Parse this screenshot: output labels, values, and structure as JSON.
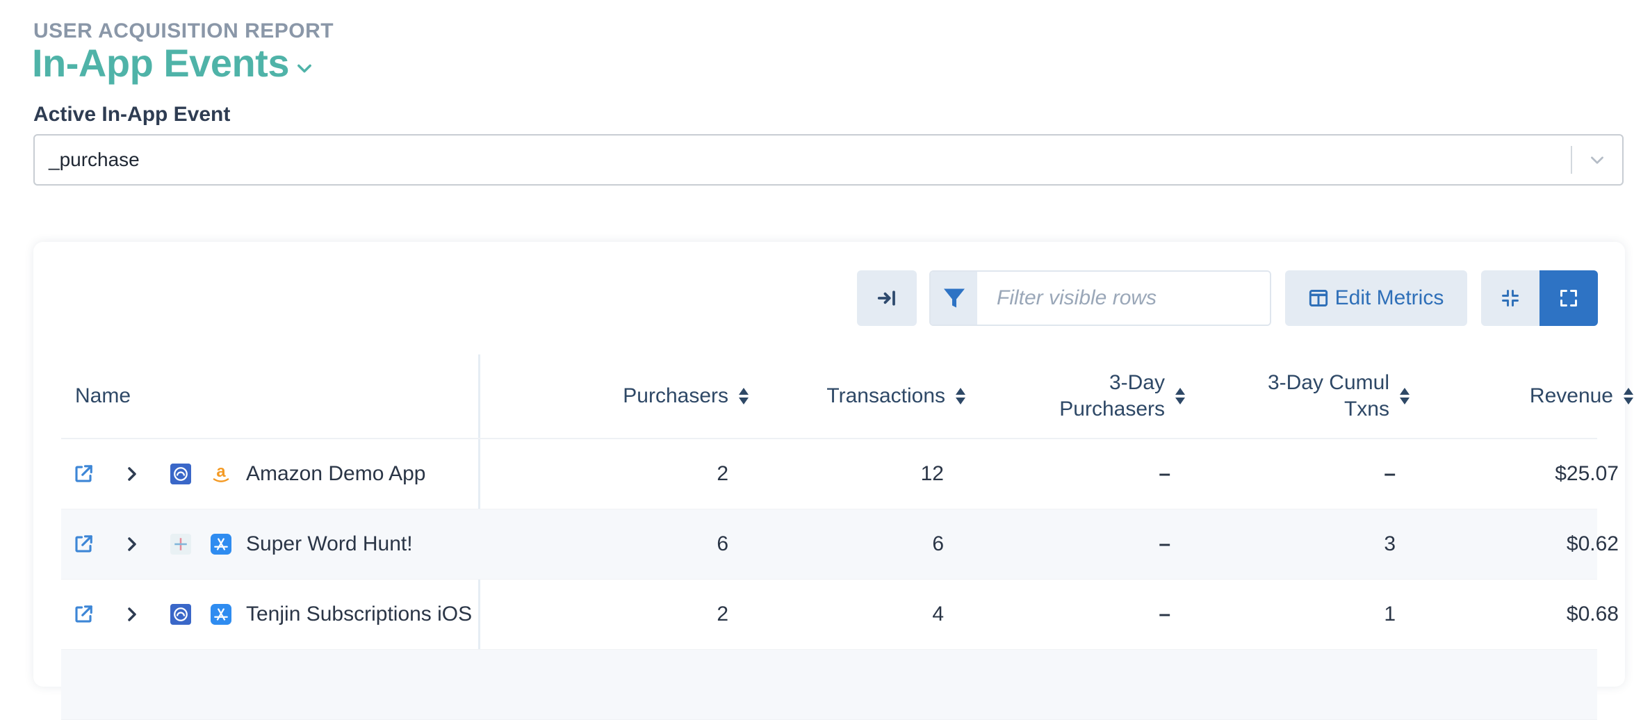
{
  "header": {
    "eyebrow": "USER ACQUISITION REPORT",
    "title": "In-App Events"
  },
  "event_select": {
    "label": "Active In-App Event",
    "value": "_purchase"
  },
  "toolbar": {
    "filter_placeholder": "Filter visible rows",
    "edit_metrics_label": "Edit Metrics"
  },
  "table": {
    "columns": {
      "name": "Name",
      "purchasers": "Purchasers",
      "transactions": "Transactions",
      "three_day_purchasers_1": "3-Day",
      "three_day_purchasers_2": "Purchasers",
      "three_day_cumul_1": "3-Day Cumul",
      "three_day_cumul_2": "Txns",
      "revenue": "Revenue"
    },
    "rows": [
      {
        "name": "Amazon Demo App",
        "platform_icon": "android-icon",
        "store_icon": "amazon-icon",
        "purchasers": "2",
        "transactions": "12",
        "three_day_purchasers": "–",
        "three_day_cumul_txns": "–",
        "revenue": "$25.07"
      },
      {
        "name": "Super Word Hunt!",
        "platform_icon": "crosshair-icon",
        "store_icon": "app-store-icon",
        "purchasers": "6",
        "transactions": "6",
        "three_day_purchasers": "–",
        "three_day_cumul_txns": "3",
        "revenue": "$0.62"
      },
      {
        "name": "Tenjin Subscriptions iOS",
        "platform_icon": "android-icon",
        "store_icon": "app-store-icon",
        "purchasers": "2",
        "transactions": "4",
        "three_day_purchasers": "–",
        "three_day_cumul_txns": "1",
        "revenue": "$0.68"
      }
    ]
  },
  "colors": {
    "accent": "#4fb3a8",
    "primary": "#2e73c4",
    "button_bg": "#e4ebf3"
  }
}
